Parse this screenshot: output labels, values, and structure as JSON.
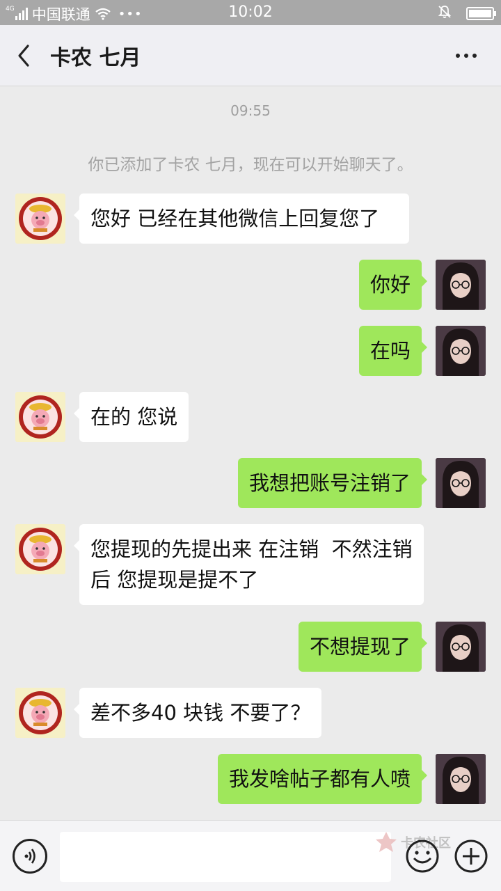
{
  "status_bar": {
    "network": "4G",
    "carrier": "中国联通",
    "time": "10:02"
  },
  "nav": {
    "title": "卡农 七月",
    "back_icon": "chevron-left-icon",
    "more_icon": "more-dots-icon"
  },
  "chat": {
    "time_label": "09:55",
    "system_message": "你已添加了卡农 七月，现在可以开始聊天了。",
    "messages": [
      {
        "side": "left",
        "text": "您好 已经在其他微信上回复您了"
      },
      {
        "side": "right",
        "text": "你好"
      },
      {
        "side": "right",
        "text": "在吗"
      },
      {
        "side": "left",
        "text": "在的 您说"
      },
      {
        "side": "right",
        "text": "我想把账号注销了"
      },
      {
        "side": "left",
        "text": "您提现的先提出来 在注销  不然注销后 您提现是提不了"
      },
      {
        "side": "right",
        "text": "不想提现了"
      },
      {
        "side": "left",
        "text": "差不多40 块钱 不要了？"
      },
      {
        "side": "right",
        "text": "我发啥帖子都有人喷"
      }
    ]
  },
  "input_bar": {
    "voice_icon": "voice-icon",
    "emoji_icon": "emoji-icon",
    "add_icon": "plus-circle-icon",
    "value": ""
  },
  "watermark": {
    "text": "卡农社区"
  },
  "colors": {
    "status_bar_bg": "#a8a8a8",
    "chat_bg": "#ebebeb",
    "sent_bubble": "#9fe75b",
    "received_bubble": "#ffffff"
  }
}
